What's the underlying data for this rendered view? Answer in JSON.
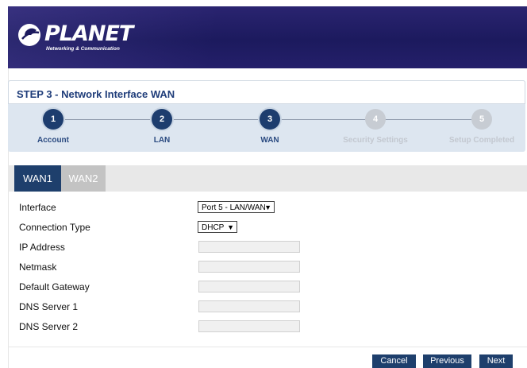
{
  "brand": {
    "name": "PLANET",
    "tagline": "Networking & Communication"
  },
  "wizard": {
    "title": "STEP 3 - Network Interface WAN",
    "steps": [
      {
        "number": "1",
        "label": "Account",
        "state": "done"
      },
      {
        "number": "2",
        "label": "LAN",
        "state": "done"
      },
      {
        "number": "3",
        "label": "WAN",
        "state": "current"
      },
      {
        "number": "4",
        "label": "Security Settings",
        "state": "pending"
      },
      {
        "number": "5",
        "label": "Setup Completed",
        "state": "pending"
      }
    ]
  },
  "tabs": [
    {
      "label": "WAN1",
      "active": true
    },
    {
      "label": "WAN2",
      "active": false
    }
  ],
  "form": {
    "interface": {
      "label": "Interface",
      "value": "Port 5 - LAN/WAN"
    },
    "connection_type": {
      "label": "Connection Type",
      "value": "DHCP"
    },
    "ip_address": {
      "label": "IP Address",
      "value": ""
    },
    "netmask": {
      "label": "Netmask",
      "value": ""
    },
    "default_gateway": {
      "label": "Default Gateway",
      "value": ""
    },
    "dns1": {
      "label": "DNS Server 1",
      "value": ""
    },
    "dns2": {
      "label": "DNS Server 2",
      "value": ""
    }
  },
  "buttons": {
    "cancel": "Cancel",
    "previous": "Previous",
    "next": "Next"
  },
  "colors": {
    "primary": "#1e3f6c",
    "banner": "#1c1a5e",
    "wizard_bg": "#dde6f0",
    "inactive": "#c3c3c3"
  },
  "icons": {
    "logo": "planet-logo-icon",
    "select_arrow": "chevron-down-icon"
  }
}
